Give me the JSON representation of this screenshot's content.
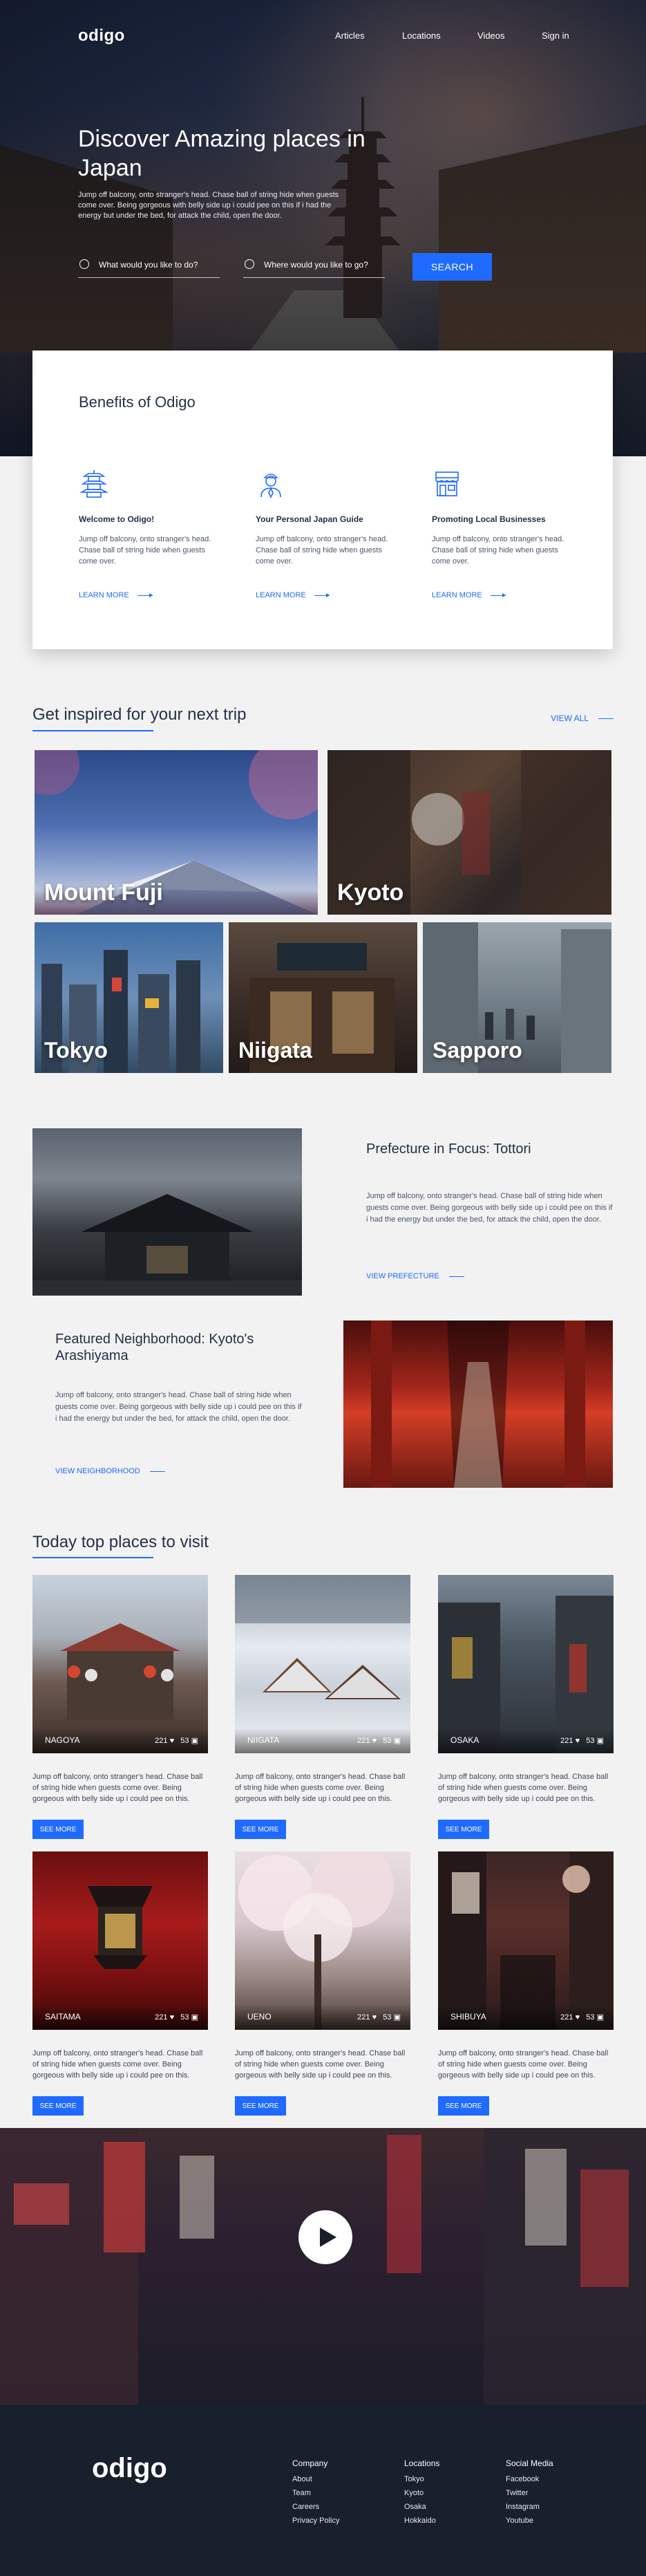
{
  "nav": {
    "logo": "odigo",
    "links": [
      "Articles",
      "Locations",
      "Videos",
      "Sign in"
    ]
  },
  "hero": {
    "title": "Discover Amazing places in Japan",
    "description": "Jump off balcony, onto stranger's head. Chase ball of string hide when guests come over. Being gorgeous with belly side up i could pee on this if i had the energy but under the bed, for attack the child, open the door.",
    "what_placeholder": "What would you like to do?",
    "where_placeholder": "Where would you like to go?",
    "search_label": "SEARCH"
  },
  "benefits": {
    "title": "Benefits of Odigo",
    "items": [
      {
        "icon": "pagoda-icon",
        "title": "Welcome to Odigo!",
        "text": "Jump off balcony, onto stranger's head. Chase ball of string hide when guests come over.",
        "link": "LEARN MORE"
      },
      {
        "icon": "guide-person-icon",
        "title": "Your Personal Japan Guide",
        "text": "Jump off balcony, onto stranger's head. Chase ball of string hide when guests come over.",
        "link": "LEARN MORE"
      },
      {
        "icon": "shop-icon",
        "title": "Promoting Local Businesses",
        "text": "Jump off balcony, onto stranger's head. Chase ball of string hide when guests come over.",
        "link": "LEARN MORE"
      }
    ]
  },
  "inspired": {
    "title": "Get inspired for your next trip",
    "view_all": "VIEW ALL",
    "places": [
      "Mount Fuji",
      "Kyoto",
      "Tokyo",
      "Niigata",
      "Sapporo"
    ]
  },
  "features": [
    {
      "title": "Prefecture in Focus: Tottori",
      "text": "Jump off balcony, onto stranger's head. Chase ball of string hide when guests come over. Being gorgeous with belly side up i could pee on this if i had the energy but under the bed, for attack the child, open the door.",
      "link": "VIEW PREFECTURE"
    },
    {
      "title": "Featured Neighborhood: Kyoto's Arashiyama",
      "text": "Jump off balcony, onto stranger's head. Chase ball of string hide when guests come over. Being gorgeous with belly side up i could pee on this if i had the energy but under the bed, for attack the child, open the door.",
      "link": "VIEW NEIGHBORHOOD"
    }
  ],
  "top_places": {
    "title": "Today top places to visit",
    "cards": [
      {
        "city": "NAGOYA",
        "likes": "221",
        "comments": "53",
        "text": "Jump off balcony, onto stranger's head. Chase ball of string hide when guests come over. Being gorgeous with belly side up i could pee on this.",
        "button": "SEE MORE"
      },
      {
        "city": "NIIGATA",
        "likes": "221",
        "comments": "53",
        "text": "Jump off balcony, onto stranger's head. Chase ball of string hide when guests come over. Being gorgeous with belly side up i could pee on this.",
        "button": "SEE MORE"
      },
      {
        "city": "OSAKA",
        "likes": "221",
        "comments": "53",
        "text": "Jump off balcony, onto stranger's head. Chase ball of string hide when guests come over. Being gorgeous with belly side up i could pee on this.",
        "button": "SEE MORE"
      },
      {
        "city": "SAITAMA",
        "likes": "221",
        "comments": "53",
        "text": "Jump off balcony, onto stranger's head. Chase ball of string hide when guests come over. Being gorgeous with belly side up i could pee on this.",
        "button": "SEE MORE"
      },
      {
        "city": "UENO",
        "likes": "221",
        "comments": "53",
        "text": "Jump off balcony, onto stranger's head. Chase ball of string hide when guests come over. Being gorgeous with belly side up i could pee on this.",
        "button": "SEE MORE"
      },
      {
        "city": "SHIBUYA",
        "likes": "221",
        "comments": "53",
        "text": "Jump off balcony, onto stranger's head. Chase ball of string hide when guests come over. Being gorgeous with belly side up i could pee on this.",
        "button": "SEE MORE"
      }
    ]
  },
  "footer": {
    "logo": "odigo",
    "columns": [
      {
        "title": "Company",
        "links": [
          "About",
          "Team",
          "Careers",
          "Privacy Policy"
        ]
      },
      {
        "title": "Locations",
        "links": [
          "Tokyo",
          "Kyoto",
          "Osaka",
          "Hokkaido"
        ]
      },
      {
        "title": "Social Media",
        "links": [
          "Facebook",
          "Twitter",
          "Instagram",
          "Youtube"
        ]
      }
    ]
  },
  "colors": {
    "accent": "#1f6bff",
    "heading": "#253048",
    "footer_bg": "#18202d"
  }
}
